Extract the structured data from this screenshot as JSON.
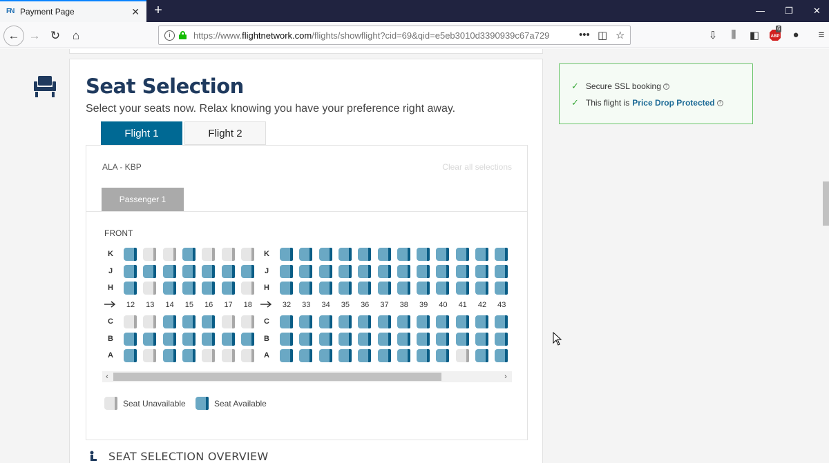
{
  "browser": {
    "tab_title": "Payment Page",
    "favicon_text": "FN",
    "url_prefix": "https://www.",
    "url_domain": "flightnetwork.com",
    "url_rest": "/flights/showflight?cid=69&qid=e5eb3010d3390939c67a729",
    "badge_count": "6"
  },
  "section": {
    "title": "Seat Selection",
    "subtitle": "Select your seats now. Relax knowing you have your preference right away."
  },
  "flight_tabs": [
    {
      "label": "Flight 1",
      "active": true
    },
    {
      "label": "Flight 2",
      "active": false
    }
  ],
  "seatmap": {
    "route": "ALA - KBP",
    "clear_label": "Clear all selections",
    "passenger_tab": "Passenger 1",
    "front_label": "FRONT",
    "left_columns": [
      "12",
      "13",
      "14",
      "15",
      "16",
      "17",
      "18"
    ],
    "right_columns": [
      "32",
      "33",
      "34",
      "35",
      "36",
      "37",
      "38",
      "39",
      "40",
      "41",
      "42",
      "43"
    ],
    "rows": [
      {
        "letter": "K",
        "left": [
          1,
          0,
          0,
          1,
          0,
          0,
          0
        ],
        "right": [
          1,
          1,
          1,
          1,
          1,
          1,
          1,
          1,
          1,
          1,
          1,
          1
        ]
      },
      {
        "letter": "J",
        "left": [
          1,
          1,
          1,
          1,
          1,
          1,
          1
        ],
        "right": [
          1,
          1,
          1,
          1,
          1,
          1,
          1,
          1,
          1,
          1,
          1,
          1
        ]
      },
      {
        "letter": "H",
        "left": [
          1,
          0,
          1,
          1,
          1,
          1,
          0
        ],
        "right": [
          1,
          1,
          1,
          1,
          1,
          1,
          1,
          1,
          1,
          1,
          1,
          1
        ]
      },
      {
        "letter": "C",
        "left": [
          0,
          0,
          1,
          1,
          1,
          0,
          0
        ],
        "right": [
          1,
          1,
          1,
          1,
          1,
          1,
          1,
          1,
          1,
          1,
          1,
          1
        ]
      },
      {
        "letter": "B",
        "left": [
          1,
          1,
          1,
          1,
          1,
          1,
          1
        ],
        "right": [
          1,
          1,
          1,
          1,
          1,
          1,
          1,
          1,
          1,
          1,
          1,
          1
        ]
      },
      {
        "letter": "A",
        "left": [
          1,
          0,
          1,
          1,
          0,
          0,
          0
        ],
        "right": [
          1,
          1,
          1,
          1,
          1,
          1,
          1,
          1,
          1,
          0,
          1,
          1
        ]
      }
    ],
    "aisle_after_row": "H",
    "legend_unavailable": "Seat Unavailable",
    "legend_available": "Seat Available",
    "colors": {
      "available": "#6aa8c4",
      "available_back": "#0a5d86",
      "unavailable": "#e6e6e6",
      "unavailable_back": "#a8a8a8"
    }
  },
  "overview_title": "SEAT SELECTION OVERVIEW",
  "ssl_box": {
    "line1": "Secure SSL booking",
    "line2_prefix": "This flight is",
    "line2_highlight": "Price Drop Protected"
  }
}
